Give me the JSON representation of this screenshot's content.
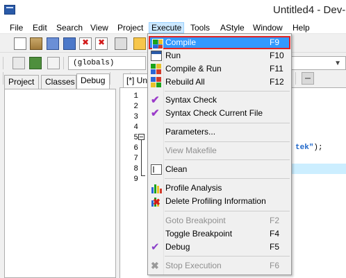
{
  "window": {
    "title": "Untitled4 - Dev-"
  },
  "menubar": {
    "items": [
      "File",
      "Edit",
      "Search",
      "View",
      "Project",
      "Execute",
      "Tools",
      "AStyle",
      "Window",
      "Help"
    ],
    "active": "Execute"
  },
  "toolbar": {
    "scope_value": "(globals)",
    "icons": [
      "new-file-icon",
      "open-project-icon",
      "save-icon",
      "save-all-icon",
      "close-file-icon",
      "close-all-icon",
      "print-icon",
      "edit-icon",
      "toggle-icon"
    ]
  },
  "left_panel": {
    "tabs": [
      "Project",
      "Classes",
      "Debug"
    ],
    "selected_tab": "Debug"
  },
  "editor": {
    "tab_label": "[*] Unt",
    "line_numbers": [
      "1",
      "2",
      "3",
      "4",
      "5",
      "6",
      "7",
      "8",
      "9"
    ],
    "code_fragment_string": "tek\"",
    "code_fragment_tail": ");"
  },
  "execute_menu": {
    "items": [
      {
        "label": "Compile",
        "shortcut": "F9",
        "icon": "compile-icon",
        "enabled": true,
        "highlighted": true
      },
      {
        "label": "Run",
        "shortcut": "F10",
        "icon": "run-icon",
        "enabled": true
      },
      {
        "label": "Compile & Run",
        "shortcut": "F11",
        "icon": "compile-run-icon",
        "enabled": true
      },
      {
        "label": "Rebuild All",
        "shortcut": "F12",
        "icon": "rebuild-icon",
        "enabled": true
      },
      {
        "label": "Syntax Check",
        "shortcut": "",
        "icon": "syntax-check-icon",
        "enabled": true
      },
      {
        "label": "Syntax Check Current File",
        "shortcut": "",
        "icon": "syntax-check-file-icon",
        "enabled": true
      },
      {
        "label": "Parameters...",
        "shortcut": "",
        "icon": "",
        "enabled": true
      },
      {
        "label": "View Makefile",
        "shortcut": "",
        "icon": "",
        "enabled": false
      },
      {
        "label": "Clean",
        "shortcut": "",
        "icon": "clean-icon",
        "enabled": true
      },
      {
        "label": "Profile Analysis",
        "shortcut": "",
        "icon": "profile-icon",
        "enabled": true
      },
      {
        "label": "Delete Profiling Information",
        "shortcut": "",
        "icon": "delete-profile-icon",
        "enabled": true
      },
      {
        "label": "Goto Breakpoint",
        "shortcut": "F2",
        "icon": "",
        "enabled": false
      },
      {
        "label": "Toggle Breakpoint",
        "shortcut": "F4",
        "icon": "",
        "enabled": true
      },
      {
        "label": "Debug",
        "shortcut": "F5",
        "icon": "debug-icon",
        "enabled": true
      },
      {
        "label": "Stop Execution",
        "shortcut": "F6",
        "icon": "stop-icon",
        "enabled": false
      }
    ]
  },
  "colors": {
    "highlight": "#3399ff",
    "highlight_border": "#e02020",
    "string_literal": "#1b64c8",
    "current_line": "#cceeff"
  }
}
